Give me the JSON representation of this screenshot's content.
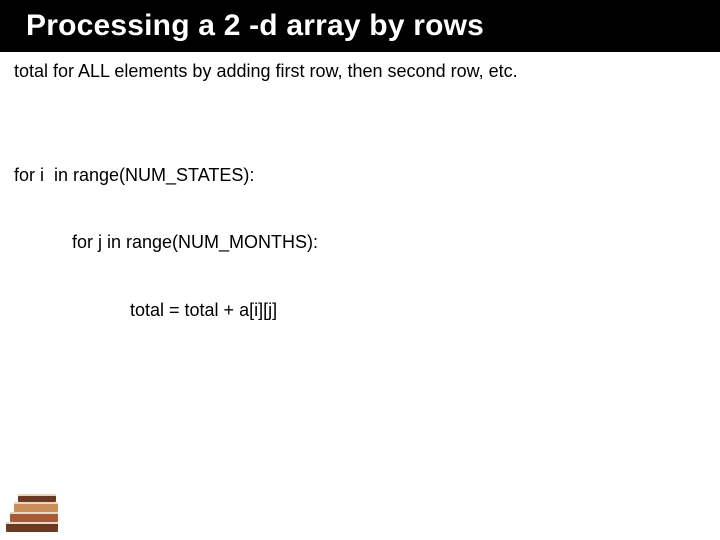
{
  "title": "Processing a 2 -d array by rows",
  "description": "total for ALL elements by adding first row, then second row, etc.",
  "code": {
    "line1": "for i  in range(NUM_STATES):",
    "line2": "for j in range(NUM_MONTHS):",
    "line3": "total = total + a[i][j]"
  },
  "colors": {
    "title_bg": "#000000",
    "title_fg": "#ffffff",
    "book_dark": "#6b3a22",
    "book_mid": "#a55a3a",
    "book_light": "#c98e5a",
    "book_page": "#e8d8c0"
  }
}
